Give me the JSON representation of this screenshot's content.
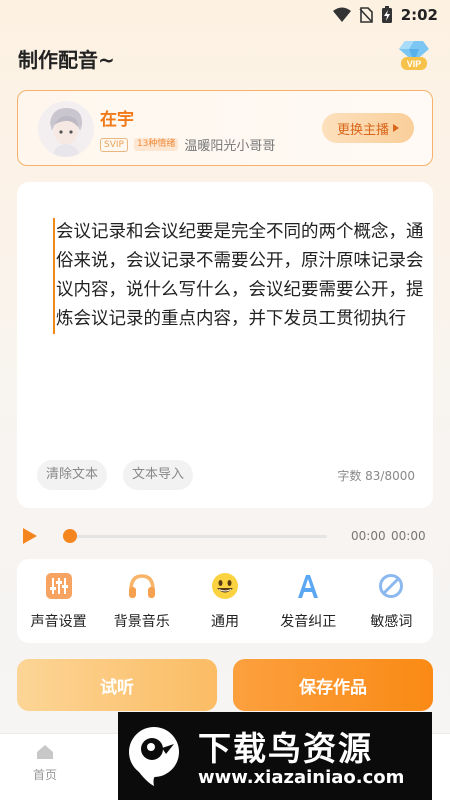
{
  "status_bar": {
    "time": "2:02"
  },
  "header": {
    "title": "制作配音~",
    "vip_label": "VIP"
  },
  "anchor": {
    "name": "在宇",
    "svip_tag": "SVIP",
    "emotion_tag": "13种情绪",
    "description": "温暖阳光小哥哥",
    "change_label": "更换主播"
  },
  "editor": {
    "text": "会议记录和会议纪要是完全不同的两个概念，通俗来说，会议记录不需要公开，原汁原味记录会议内容，说什么写什么，会议纪要需要公开，提炼会议记录的重点内容，并下发员工贯彻执行",
    "clear_label": "清除文本",
    "import_label": "文本导入",
    "char_count": "字数 83/8000"
  },
  "player": {
    "current_time": "00:00",
    "total_time": "00:00",
    "progress": 0
  },
  "tools": [
    {
      "label": "声音设置",
      "icon": "sliders-icon"
    },
    {
      "label": "背景音乐",
      "icon": "headphones-icon"
    },
    {
      "label": "通用",
      "icon": "smiley-icon"
    },
    {
      "label": "发音纠正",
      "icon": "letter-a-icon"
    },
    {
      "label": "敏感词",
      "icon": "forbidden-icon"
    }
  ],
  "actions": {
    "listen_label": "试听",
    "save_label": "保存作品"
  },
  "tabbar": {
    "home_label": "首页"
  },
  "watermark": {
    "title": "下载鸟资源",
    "url": "www.xiazainiao.com"
  },
  "colors": {
    "accent": "#f5861f",
    "accent_light": "#fbbc64",
    "card_border": "#f6b26a"
  }
}
